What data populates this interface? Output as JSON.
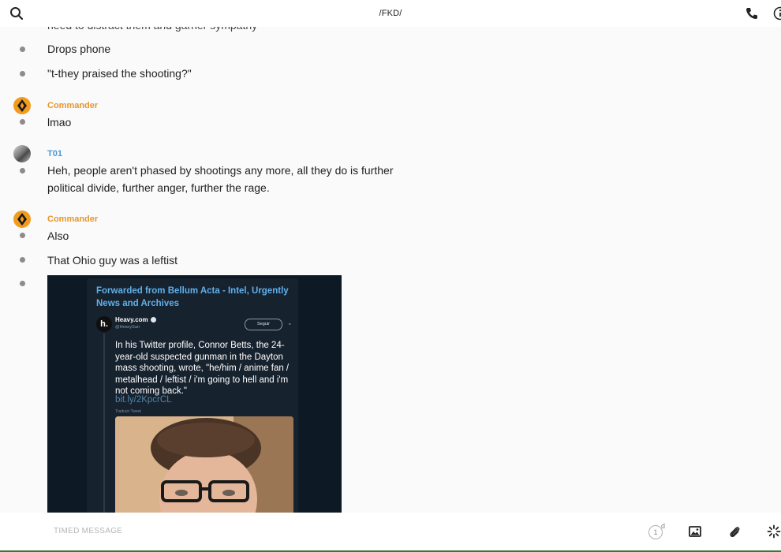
{
  "header": {
    "title": "/FKD/"
  },
  "icons": {
    "search": "search-icon",
    "phone": "phone-icon",
    "info": "info-icon",
    "image": "image-icon",
    "attach": "paperclip-icon",
    "loading": "spinner-icon"
  },
  "messages": {
    "cut_off_text": "need to distract them and garner sympathy",
    "m1": "Drops phone",
    "m2": "\"t-they praised the shooting?\"",
    "g1": {
      "sender": "Commander",
      "text": "lmao"
    },
    "g2": {
      "sender": "T01",
      "line1": "Heh, people aren't phased by shootings any more, all they do is further",
      "line2": "political divide, further anger, further the rage."
    },
    "g3": {
      "sender": "Commander",
      "t1": "Also",
      "t2": "That Ohio guy was a leftist"
    }
  },
  "forwarded_image": {
    "forwarded_from": "Forwarded from Bellum Acta - Intel, Urgently News and Archives",
    "tweet": {
      "logo": "h.",
      "account": "Heavy.com",
      "handle": "@HeavySan",
      "follow": "Seguir",
      "text": "In his Twitter profile, Connor Betts, the 24-year-old suspected gunman in the Dayton mass shooting, wrote, \"he/him / anime fan / metalhead / leftist / i'm going to hell and i'm not coming back.\"",
      "link": "bit.ly/2KpcrCL",
      "translate": "Traducir Tweet"
    }
  },
  "composer": {
    "timed_label": "TIMED MESSAGE",
    "timer_value": "1",
    "timer_unit": "d"
  },
  "colors": {
    "commander": "#e8962c",
    "t01": "#4a9ad6",
    "link": "#5fb0ec"
  }
}
